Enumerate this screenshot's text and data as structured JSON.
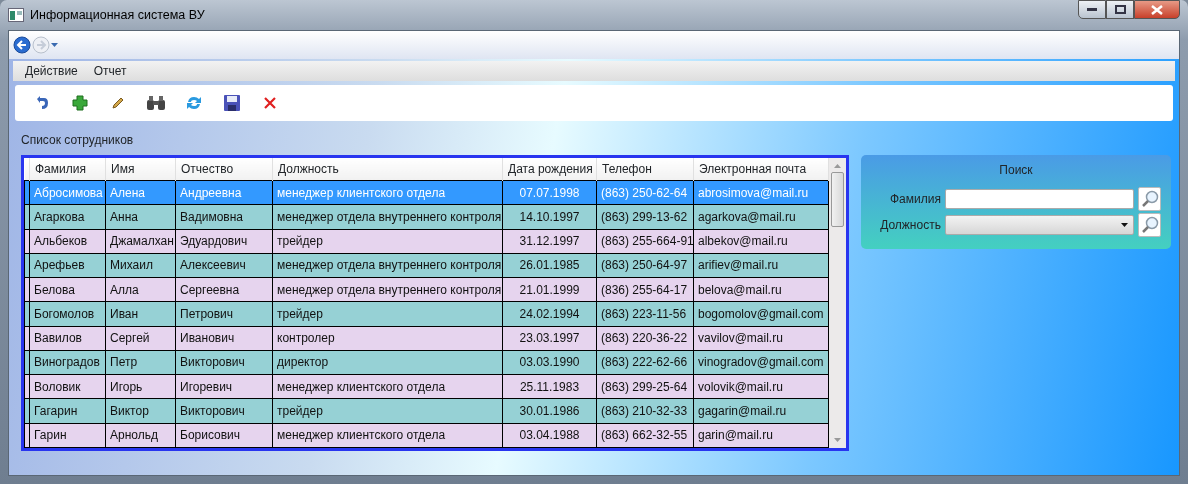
{
  "window": {
    "title": "Информационная система ВУ"
  },
  "menu": [
    {
      "label": "Действие"
    },
    {
      "label": "Отчет"
    }
  ],
  "list_title": "Список сотрудников",
  "table": {
    "columns": [
      "Фамилия",
      "Имя",
      "Отчество",
      "Должность",
      "Дата рождения",
      "Телефон",
      "Электронная почта"
    ],
    "rows": [
      {
        "selected": true,
        "cells": [
          "Абросимова",
          "Алена",
          "Андреевна",
          "менеджер клиентского отдела",
          "07.07.1998",
          "(863) 250-62-64",
          "abrosimova@mail.ru"
        ]
      },
      {
        "selected": false,
        "cells": [
          "Агаркова",
          "Анна",
          "Вадимовна",
          "менеджер отдела внутреннего контроля",
          "14.10.1997",
          "(863) 299-13-62",
          "agarkova@mail.ru"
        ]
      },
      {
        "selected": false,
        "cells": [
          "Альбеков",
          "Джамалхан",
          "Эдуардович",
          "трейдер",
          "31.12.1997",
          "(863) 255-664-91",
          "albekov@mail.ru"
        ]
      },
      {
        "selected": false,
        "cells": [
          "Арефьев",
          "Михаил",
          "Алексеевич",
          "менеджер отдела внутреннего контроля",
          "26.01.1985",
          "(863) 250-64-97",
          "arifiev@mail.ru"
        ]
      },
      {
        "selected": false,
        "cells": [
          "Белова",
          "Алла",
          "Сергеевна",
          "менеджер отдела внутреннего контроля",
          "21.01.1999",
          "(836) 255-64-17",
          "belova@mail.ru"
        ]
      },
      {
        "selected": false,
        "cells": [
          "Богомолов",
          "Иван",
          "Петрович",
          "трейдер",
          "24.02.1994",
          "(863) 223-11-56",
          "bogomolov@gmail.com"
        ]
      },
      {
        "selected": false,
        "cells": [
          "Вавилов",
          "Сергей",
          "Иванович",
          "контролер",
          "23.03.1997",
          "(863) 220-36-22",
          "vavilov@mail.ru"
        ]
      },
      {
        "selected": false,
        "cells": [
          "Виноградов",
          "Петр",
          "Викторович",
          "директор",
          "03.03.1990",
          "(863) 222-62-66",
          "vinogradov@gmail.com"
        ]
      },
      {
        "selected": false,
        "cells": [
          "Воловик",
          "Игорь",
          "Игоревич",
          "менеджер клиентского отдела",
          "25.11.1983",
          "(863) 299-25-64",
          "volovik@mail.ru"
        ]
      },
      {
        "selected": false,
        "cells": [
          "Гагарин",
          "Виктор",
          "Викторович",
          "трейдер",
          "30.01.1986",
          "(863) 210-32-33",
          "gagarin@mail.ru"
        ]
      },
      {
        "selected": false,
        "cells": [
          "Гарин",
          "Арнольд",
          "Борисович",
          "менеджер клиентского отдела",
          "03.04.1988",
          "(863) 662-32-55",
          "garin@mail.ru"
        ]
      }
    ]
  },
  "search": {
    "title": "Поиск",
    "fields": [
      {
        "kind": "text",
        "label": "Фамилия"
      },
      {
        "kind": "select",
        "label": "Должность"
      }
    ]
  }
}
